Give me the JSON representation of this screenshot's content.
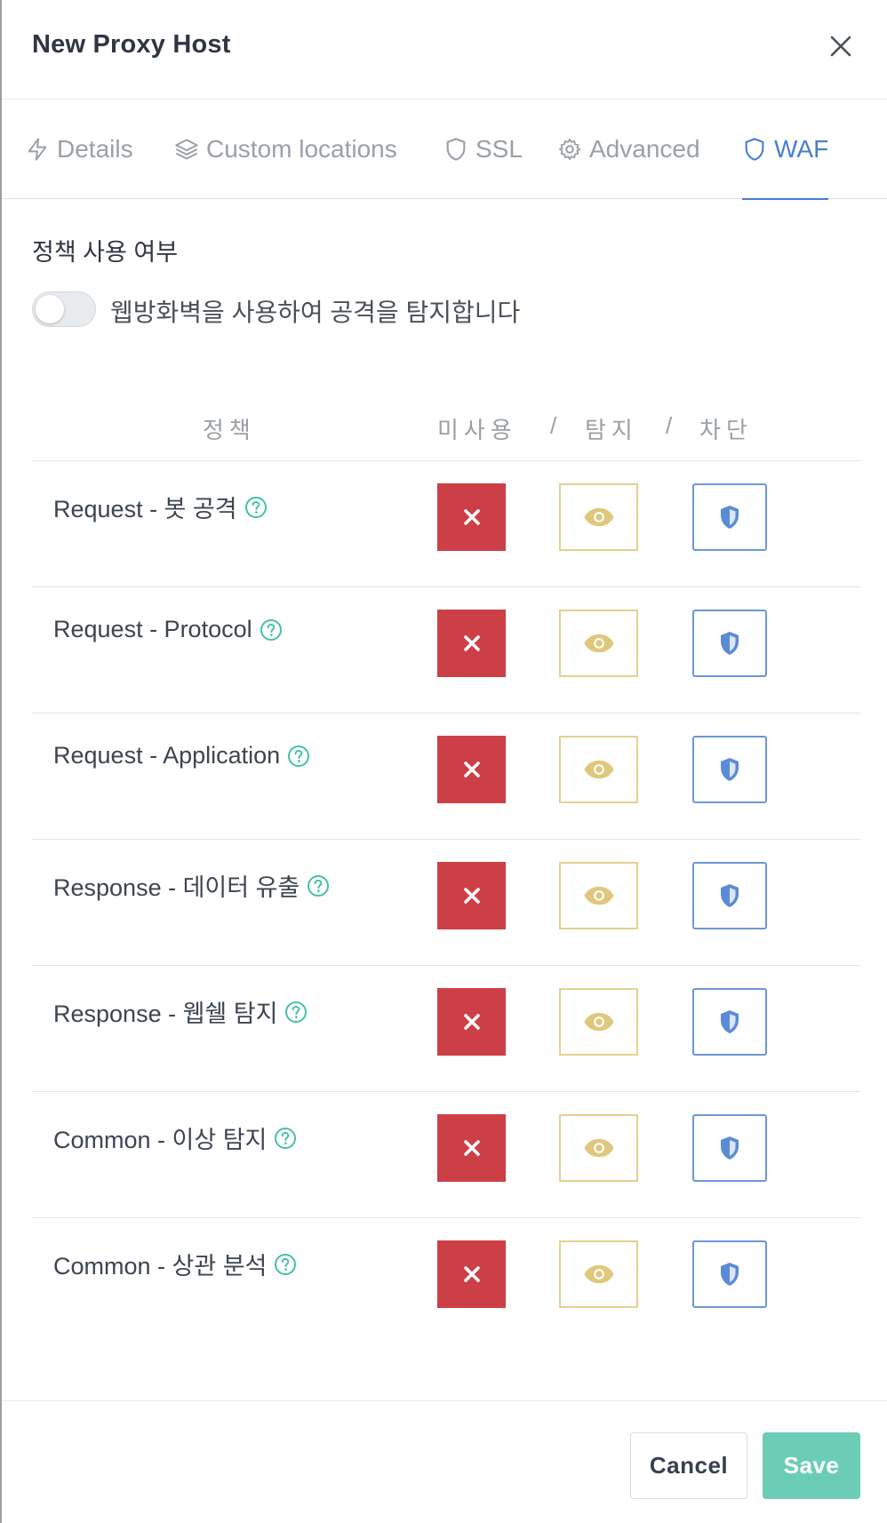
{
  "modal": {
    "title": "New Proxy Host"
  },
  "tabs": [
    {
      "label": "Details",
      "icon": "lightning-icon"
    },
    {
      "label": "Custom locations",
      "icon": "layers-icon"
    },
    {
      "label": "SSL",
      "icon": "shield-icon"
    },
    {
      "label": "Advanced",
      "icon": "gear-icon"
    },
    {
      "label": "WAF",
      "icon": "shield-icon",
      "active": true
    }
  ],
  "waf": {
    "section_label": "정책 사용 여부",
    "toggle_label": "웹방화벽을 사용하여 공격을 탐지합니다",
    "toggle_on": false,
    "columns": {
      "policy": "정책",
      "off": "미사용",
      "sep1": "/",
      "detect": "탐지",
      "sep2": "/",
      "block": "차단"
    },
    "policies": [
      {
        "label": "Request - 봇 공격"
      },
      {
        "label": "Request - Protocol"
      },
      {
        "label": "Request - Application"
      },
      {
        "label": "Response - 데이터 유출"
      },
      {
        "label": "Response - 웹쉘 탐지"
      },
      {
        "label": "Common - 이상 탐지"
      },
      {
        "label": "Common - 상관 분석"
      }
    ]
  },
  "footer": {
    "cancel_label": "Cancel",
    "save_label": "Save"
  },
  "colors": {
    "accent": "#467fcf",
    "off": "#cd3f46",
    "detect": "#e5d08f",
    "block": "#6d96d8",
    "help": "#45c0a8",
    "save": "#6ccdb7"
  }
}
